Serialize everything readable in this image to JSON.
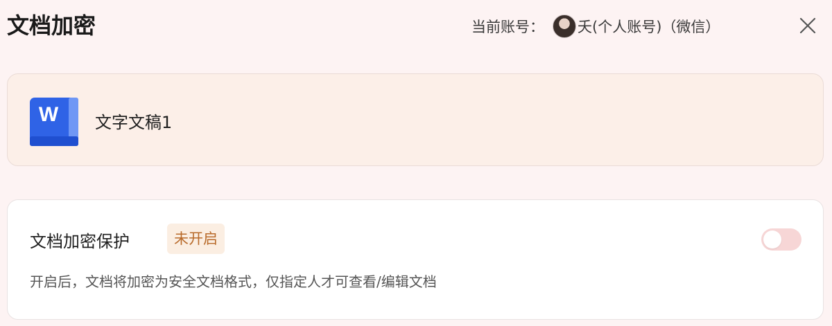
{
  "dialog": {
    "title": "文档加密",
    "account_label": "当前账号：",
    "account_name": "夭(个人账号)（微信）"
  },
  "file": {
    "name": "文字文稿1",
    "icon_letter": "W",
    "icon_color": "#2f63e6"
  },
  "encryption": {
    "label": "文档加密保护",
    "status_badge": "未开启",
    "enabled": false,
    "description": "开启后，文档将加密为安全文档格式，仅指定人才可查看/编辑文档"
  },
  "colors": {
    "background": "#fdf3f3",
    "file_card_bg": "#fcefe8",
    "badge_text": "#b86a2a",
    "toggle_off": "#f7d6d6"
  }
}
